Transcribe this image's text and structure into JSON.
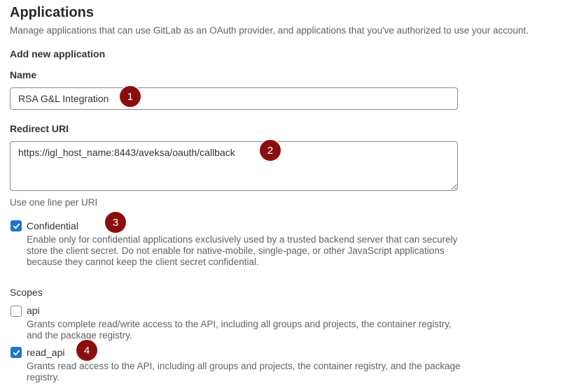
{
  "header": {
    "title": "Applications",
    "description": "Manage applications that can use GitLab as an OAuth provider, and applications that you've authorized to use your account."
  },
  "form": {
    "section_title": "Add new application",
    "name": {
      "label": "Name",
      "value": "RSA G&L Integration"
    },
    "redirect_uri": {
      "label": "Redirect URI",
      "value": "https://igl_host_name:8443/aveksa/oauth/callback",
      "help": "Use one line per URI"
    },
    "confidential": {
      "label": "Confidential",
      "checked": true,
      "help": "Enable only for confidential applications exclusively used by a trusted backend server that can securely store the client secret. Do not enable for native-mobile, single-page, or other JavaScript applications because they cannot keep the client secret confidential."
    },
    "scopes": {
      "title": "Scopes",
      "items": [
        {
          "label": "api",
          "checked": false,
          "help": "Grants complete read/write access to the API, including all groups and projects, the container registry, and the package registry."
        },
        {
          "label": "read_api",
          "checked": true,
          "help": "Grants read access to the API, including all groups and projects, the container registry, and the package registry."
        }
      ]
    }
  },
  "markers": [
    "1",
    "2",
    "3",
    "4"
  ],
  "colors": {
    "accent": "#1f75cb",
    "marker": "#8b0e0e"
  },
  "icons": {
    "checkbox_checked": "check-icon"
  }
}
